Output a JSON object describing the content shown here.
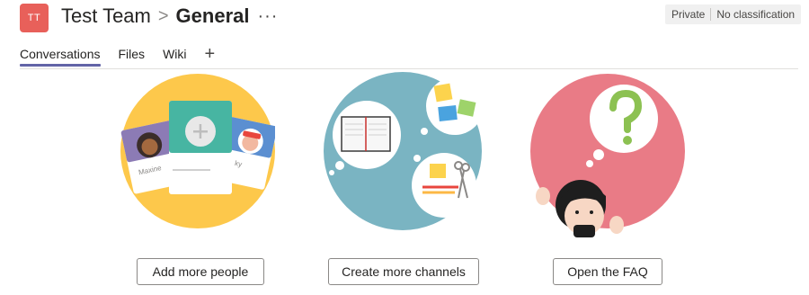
{
  "header": {
    "avatar_initials": "TT",
    "team_name": "Test Team",
    "separator": ">",
    "channel_name": "General",
    "more": "···"
  },
  "badge": {
    "privacy": "Private",
    "classification": "No classification"
  },
  "tabs": [
    {
      "label": "Conversations",
      "active": true
    },
    {
      "label": "Files",
      "active": false
    },
    {
      "label": "Wiki",
      "active": false
    }
  ],
  "tab_add": "+",
  "illustrations": {
    "people_card_left_name": "Maxine",
    "people_card_right_name": "ky"
  },
  "actions": {
    "add_people": "Add more people",
    "create_channels": "Create more channels",
    "open_faq": "Open the FAQ"
  },
  "colors": {
    "accent": "#6264a7",
    "avatar": "#e8605a",
    "people_bg": "#fdc84b",
    "channels_bg": "#7ab4c2",
    "faq_bg": "#e97b86"
  }
}
